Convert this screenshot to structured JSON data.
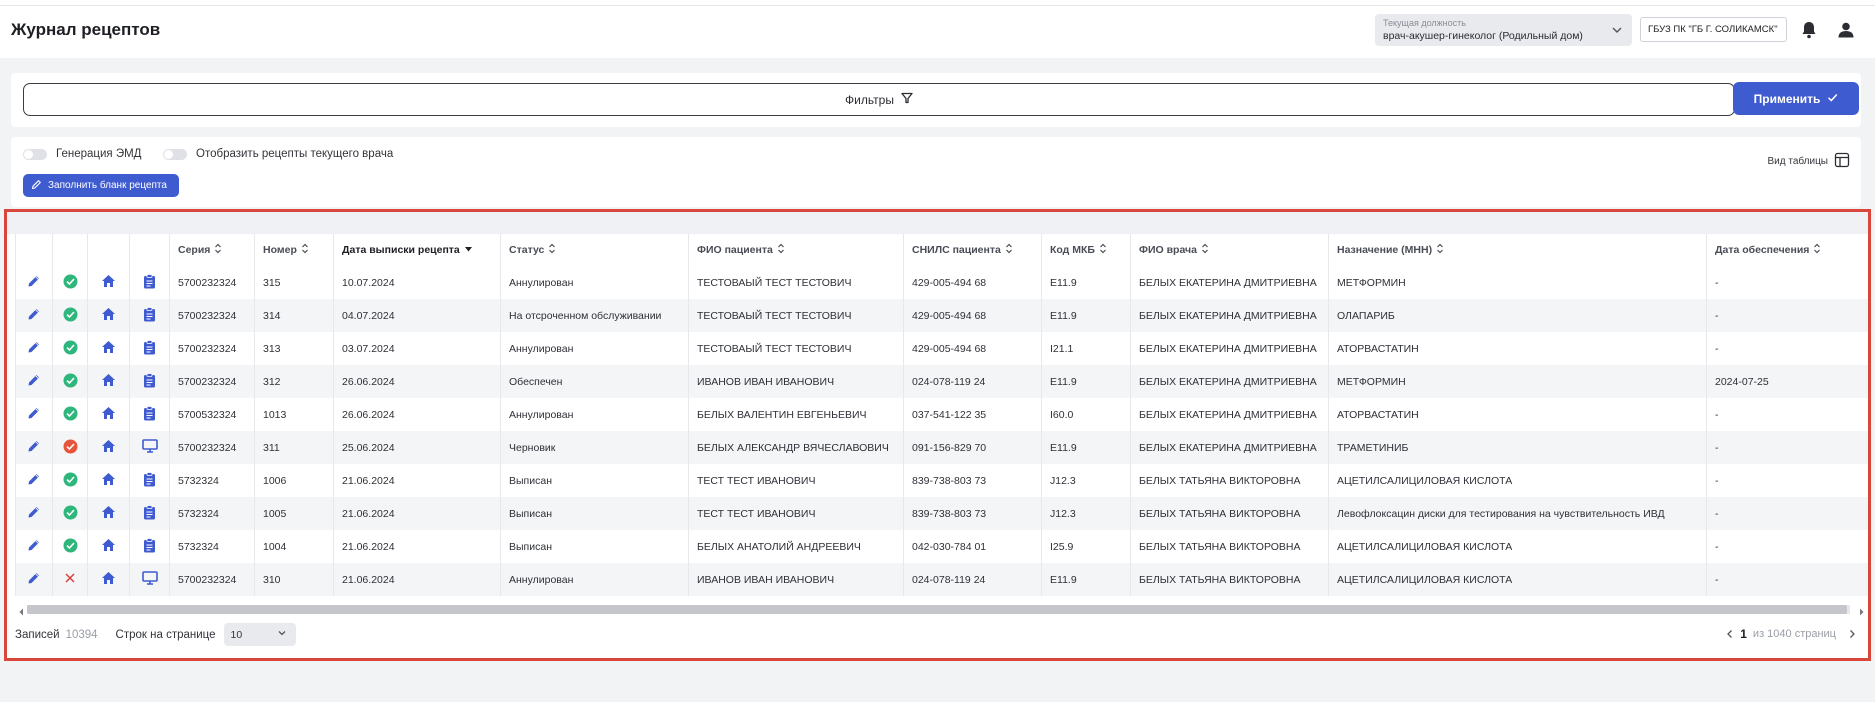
{
  "header": {
    "title": "Журнал рецептов",
    "position_label": "Текущая должность",
    "position_value": "врач-акушер-гинеколог (Родильный дом)",
    "org": "ГБУЗ ПК \"ГБ Г. СОЛИКАМСК\""
  },
  "filters": {
    "label": "Фильтры",
    "apply_label": "Применить"
  },
  "toolbar": {
    "emd_toggle_label": "Генерация ЭМД",
    "current_doctor_toggle_label": "Отобразить рецепты текущего врача",
    "fill_button_label": "Заполнить бланк рецепта",
    "view_label": "Вид таблицы"
  },
  "table": {
    "columns": [
      "Серия",
      "Номер",
      "Дата выписки рецепта",
      "Статус",
      "ФИО пациента",
      "СНИЛС пациента",
      "Код МКБ",
      "ФИО врача",
      "Назначение (МНН)",
      "Дата обеспечения"
    ],
    "rows": [
      {
        "status_icon": "check",
        "doc_icon": "clipboard",
        "cells": [
          "5700232324",
          "315",
          "10.07.2024",
          "Аннулирован",
          "ТЕСТОВАЫЙ ТЕСТ ТЕСТОВИЧ",
          "429-005-494 68",
          "E11.9",
          "БЕЛЫХ ЕКАТЕРИНА ДМИТРИЕВНА",
          "МЕТФОРМИН",
          "-"
        ]
      },
      {
        "status_icon": "check",
        "doc_icon": "clipboard",
        "cells": [
          "5700232324",
          "314",
          "04.07.2024",
          "На отсроченном обслуживании",
          "ТЕСТОВАЫЙ ТЕСТ ТЕСТОВИЧ",
          "429-005-494 68",
          "E11.9",
          "БЕЛЫХ ЕКАТЕРИНА ДМИТРИЕВНА",
          "ОЛАПАРИБ",
          "-"
        ]
      },
      {
        "status_icon": "check",
        "doc_icon": "clipboard",
        "cells": [
          "5700232324",
          "313",
          "03.07.2024",
          "Аннулирован",
          "ТЕСТОВАЫЙ ТЕСТ ТЕСТОВИЧ",
          "429-005-494 68",
          "I21.1",
          "БЕЛЫХ ЕКАТЕРИНА ДМИТРИЕВНА",
          "АТОРВАСТАТИН",
          "-"
        ]
      },
      {
        "status_icon": "check",
        "doc_icon": "clipboard",
        "cells": [
          "5700232324",
          "312",
          "26.06.2024",
          "Обеспечен",
          "ИВАНОВ ИВАН ИВАНОВИЧ",
          "024-078-119 24",
          "E11.9",
          "БЕЛЫХ ЕКАТЕРИНА ДМИТРИЕВНА",
          "МЕТФОРМИН",
          "2024-07-25"
        ]
      },
      {
        "status_icon": "check",
        "doc_icon": "clipboard",
        "cells": [
          "5700532324",
          "1013",
          "26.06.2024",
          "Аннулирован",
          "БЕЛЫХ ВАЛЕНТИН ЕВГЕНЬЕВИЧ",
          "037-541-122 35",
          "I60.0",
          "БЕЛЫХ ЕКАТЕРИНА ДМИТРИЕВНА",
          "АТОРВАСТАТИН",
          "-"
        ]
      },
      {
        "status_icon": "warning",
        "doc_icon": "monitor",
        "cells": [
          "5700232324",
          "311",
          "25.06.2024",
          "Черновик",
          "БЕЛЫХ АЛЕКСАНДР ВЯЧЕСЛАВОВИЧ",
          "091-156-829 70",
          "E11.9",
          "БЕЛЫХ ЕКАТЕРИНА ДМИТРИЕВНА",
          "ТРАМЕТИНИБ",
          "-"
        ]
      },
      {
        "status_icon": "check",
        "doc_icon": "clipboard",
        "cells": [
          "5732324",
          "1006",
          "21.06.2024",
          "Выписан",
          "ТЕСТ ТЕСТ ИВАНОВИЧ",
          "839-738-803 73",
          "J12.3",
          "БЕЛЫХ ТАТЬЯНА ВИКТОРОВНА",
          "АЦЕТИЛСАЛИЦИЛОВАЯ КИСЛОТА",
          "-"
        ]
      },
      {
        "status_icon": "check",
        "doc_icon": "clipboard",
        "cells": [
          "5732324",
          "1005",
          "21.06.2024",
          "Выписан",
          "ТЕСТ ТЕСТ ИВАНОВИЧ",
          "839-738-803 73",
          "J12.3",
          "БЕЛЫХ ТАТЬЯНА ВИКТОРОВНА",
          "Левофлоксацин диски для тестирования на чувствительность ИВД",
          "-"
        ]
      },
      {
        "status_icon": "check",
        "doc_icon": "clipboard",
        "cells": [
          "5732324",
          "1004",
          "21.06.2024",
          "Выписан",
          "БЕЛЫХ АНАТОЛИЙ АНДРЕЕВИЧ",
          "042-030-784 01",
          "I25.9",
          "БЕЛЫХ ТАТЬЯНА ВИКТОРОВНА",
          "АЦЕТИЛСАЛИЦИЛОВАЯ КИСЛОТА",
          "-"
        ]
      },
      {
        "status_icon": "cross",
        "doc_icon": "monitor",
        "cells": [
          "5700232324",
          "310",
          "21.06.2024",
          "Аннулирован",
          "ИВАНОВ ИВАН ИВАНОВИЧ",
          "024-078-119 24",
          "E11.9",
          "БЕЛЫХ ТАТЬЯНА ВИКТОРОВНА",
          "АЦЕТИЛСАЛИЦИЛОВАЯ КИСЛОТА",
          "-"
        ]
      }
    ]
  },
  "pagination": {
    "records_label": "Записей",
    "records_count": "10394",
    "rows_per_page_label": "Строк на странице",
    "rows_per_page_value": "10",
    "current_page": "1",
    "of_pages_text": "из 1040 страниц"
  },
  "colors": {
    "accent": "#3f5bd0",
    "success": "#2eb67d",
    "warning": "#e8543b",
    "error": "#d93a3a",
    "highlight_border": "#d9463c"
  }
}
